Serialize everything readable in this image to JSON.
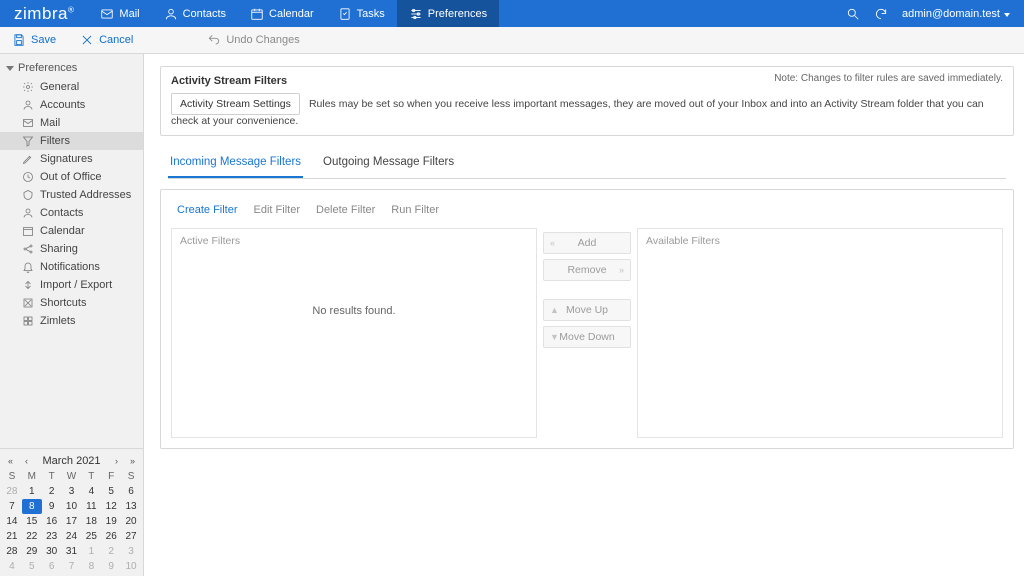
{
  "brand": "zimbra",
  "topnav": [
    {
      "key": "mail",
      "label": "Mail"
    },
    {
      "key": "contacts",
      "label": "Contacts"
    },
    {
      "key": "calendar",
      "label": "Calendar"
    },
    {
      "key": "tasks",
      "label": "Tasks"
    },
    {
      "key": "preferences",
      "label": "Preferences"
    }
  ],
  "active_topnav": "preferences",
  "user": "admin@domain.test",
  "actionbar": {
    "save": "Save",
    "cancel": "Cancel",
    "undo": "Undo Changes"
  },
  "sidebar": {
    "group_label": "Preferences",
    "items": [
      {
        "key": "general",
        "label": "General"
      },
      {
        "key": "accounts",
        "label": "Accounts"
      },
      {
        "key": "mail",
        "label": "Mail"
      },
      {
        "key": "filters",
        "label": "Filters"
      },
      {
        "key": "signatures",
        "label": "Signatures"
      },
      {
        "key": "outofoffice",
        "label": "Out of Office"
      },
      {
        "key": "trusted",
        "label": "Trusted Addresses"
      },
      {
        "key": "contacts",
        "label": "Contacts"
      },
      {
        "key": "calendar",
        "label": "Calendar"
      },
      {
        "key": "sharing",
        "label": "Sharing"
      },
      {
        "key": "notifications",
        "label": "Notifications"
      },
      {
        "key": "importexport",
        "label": "Import / Export"
      },
      {
        "key": "shortcuts",
        "label": "Shortcuts"
      },
      {
        "key": "zimlets",
        "label": "Zimlets"
      }
    ],
    "selected": "filters"
  },
  "activity_stream": {
    "title": "Activity Stream Filters",
    "note": "Note: Changes to filter rules are saved immediately.",
    "button": "Activity Stream Settings",
    "desc": "Rules may be set so when you receive less important messages, they are moved out of your Inbox and into an Activity Stream folder that you can check at your convenience."
  },
  "tabs": {
    "incoming": "Incoming Message Filters",
    "outgoing": "Outgoing Message Filters",
    "active": "incoming"
  },
  "filter_actions": {
    "create": "Create Filter",
    "edit": "Edit Filter",
    "delete": "Delete Filter",
    "run": "Run Filter"
  },
  "lists": {
    "active_label": "Active Filters",
    "available_label": "Available Filters",
    "empty": "No results found."
  },
  "mid_buttons": {
    "add": "Add",
    "remove": "Remove",
    "up": "Move Up",
    "down": "Move Down"
  },
  "calendar": {
    "title": "March 2021",
    "dow": [
      "S",
      "M",
      "T",
      "W",
      "T",
      "F",
      "S"
    ],
    "weeks": [
      [
        {
          "n": 28,
          "dim": true
        },
        {
          "n": 1
        },
        {
          "n": 2
        },
        {
          "n": 3
        },
        {
          "n": 4
        },
        {
          "n": 5
        },
        {
          "n": 6
        }
      ],
      [
        {
          "n": 7
        },
        {
          "n": 8,
          "today": true
        },
        {
          "n": 9
        },
        {
          "n": 10
        },
        {
          "n": 11
        },
        {
          "n": 12
        },
        {
          "n": 13
        }
      ],
      [
        {
          "n": 14
        },
        {
          "n": 15
        },
        {
          "n": 16
        },
        {
          "n": 17
        },
        {
          "n": 18
        },
        {
          "n": 19
        },
        {
          "n": 20
        }
      ],
      [
        {
          "n": 21
        },
        {
          "n": 22
        },
        {
          "n": 23
        },
        {
          "n": 24
        },
        {
          "n": 25
        },
        {
          "n": 26
        },
        {
          "n": 27
        }
      ],
      [
        {
          "n": 28
        },
        {
          "n": 29
        },
        {
          "n": 30
        },
        {
          "n": 31
        },
        {
          "n": 1,
          "dim": true
        },
        {
          "n": 2,
          "dim": true
        },
        {
          "n": 3,
          "dim": true
        }
      ],
      [
        {
          "n": 4,
          "dim": true
        },
        {
          "n": 5,
          "dim": true
        },
        {
          "n": 6,
          "dim": true
        },
        {
          "n": 7,
          "dim": true
        },
        {
          "n": 8,
          "dim": true
        },
        {
          "n": 9,
          "dim": true
        },
        {
          "n": 10,
          "dim": true
        }
      ]
    ]
  }
}
